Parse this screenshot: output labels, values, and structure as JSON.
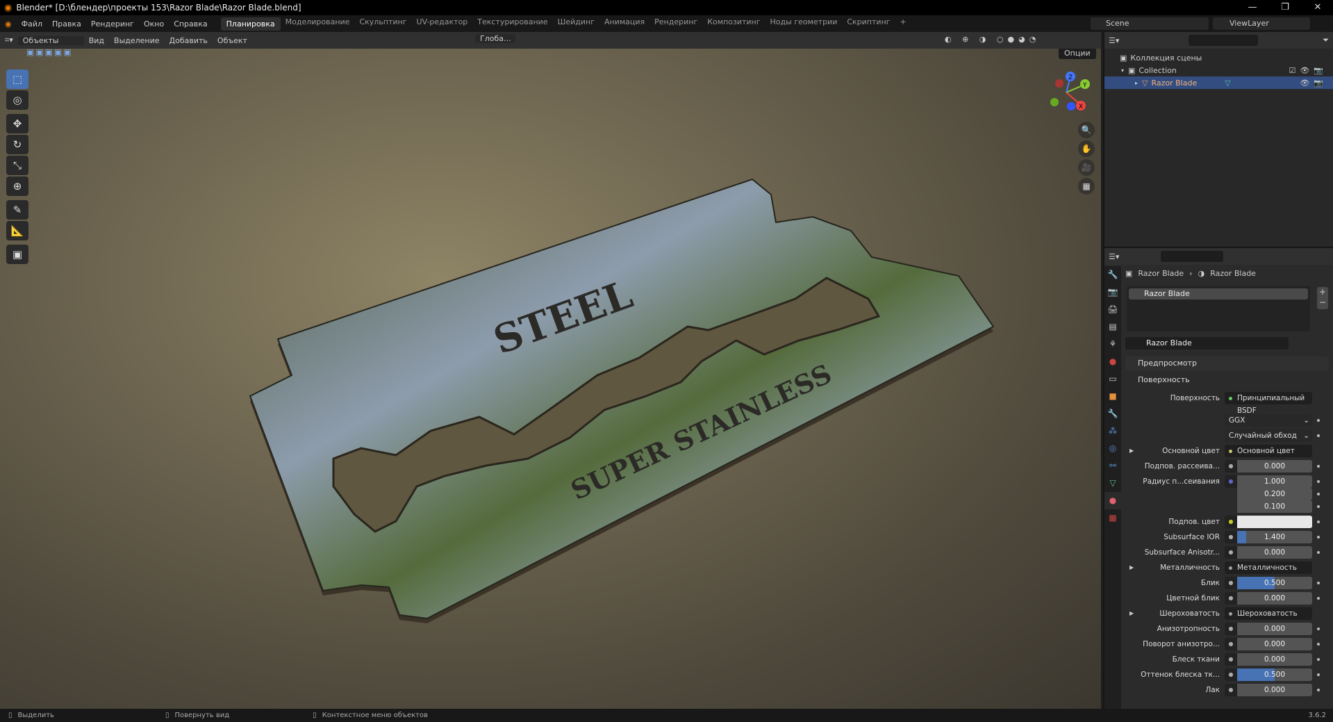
{
  "window": {
    "title": "Blender* [D:\\блендер\\проекты 153\\Razor Blade\\Razor Blade.blend]",
    "minimize": "—",
    "restore": "❐",
    "close": "✕"
  },
  "menu": [
    "Файл",
    "Правка",
    "Рендеринг",
    "Окно",
    "Справка"
  ],
  "workspaces": [
    "Планировка",
    "Моделирование",
    "Скульптинг",
    "UV-редактор",
    "Текстурирование",
    "Шейдинг",
    "Анимация",
    "Рендеринг",
    "Композитинг",
    "Ноды геометрии",
    "Скриптинг",
    "+"
  ],
  "scene": "Scene",
  "view_layer": "ViewLayer",
  "viewport_header": {
    "mode": "Объекты",
    "menus": [
      "Вид",
      "Выделение",
      "Добавить",
      "Объект"
    ],
    "orientation": "Глоба...",
    "options": "Опции"
  },
  "blade_text": {
    "top": "STEEL",
    "bottom": "SUPER  STAINLESS"
  },
  "gizmo": {
    "x": "X",
    "y": "Y",
    "z": "Z"
  },
  "outliner": {
    "scene_collection": "Коллекция сцены",
    "collection": "Collection",
    "object": "Razor Blade"
  },
  "props": {
    "breadcrumb_object": "Razor Blade",
    "breadcrumb_material": "Razor Blade",
    "slot": "Razor Blade",
    "material_name": "Razor Blade",
    "preview": "Предпросмотр",
    "surface_panel": "Поверхность",
    "surface_label": "Поверхность",
    "surface_value": "Принципиальный BSDF",
    "distribution": "GGX",
    "subsurface_method": "Случайный обход",
    "rows": [
      {
        "label": "Основной цвет",
        "link": "Основной цвет",
        "sock": "#c7c76a",
        "expand": true
      },
      {
        "label": "Подпов. рассеива...",
        "value": "0.000",
        "fill": 0
      },
      {
        "label": "Радиус п...сеивания",
        "value": "1.000",
        "fill": 0,
        "sock": "#6363c7"
      },
      {
        "label": "",
        "value": "0.200",
        "fill": 0
      },
      {
        "label": "",
        "value": "0.100",
        "fill": 0
      },
      {
        "label": "Подпов. цвет",
        "color": "#e8e8e8",
        "sock": "#c7c729"
      },
      {
        "label": "Subsurface IOR",
        "value": "1.400",
        "fill": 0.12
      },
      {
        "label": "Subsurface Anisotr...",
        "value": "0.000",
        "fill": 0
      },
      {
        "label": "Металличность",
        "link": "Металличность",
        "sock": "#a1a1a1",
        "expand": true
      },
      {
        "label": "Блик",
        "value": "0.500",
        "fill": 0.5
      },
      {
        "label": "Цветной блик",
        "value": "0.000",
        "fill": 0
      },
      {
        "label": "Шероховатость",
        "link": "Шероховатость",
        "sock": "#a1a1a1",
        "expand": true
      },
      {
        "label": "Анизотропность",
        "value": "0.000",
        "fill": 0
      },
      {
        "label": "Поворот анизотро...",
        "value": "0.000",
        "fill": 0
      },
      {
        "label": "Блеск ткани",
        "value": "0.000",
        "fill": 0
      },
      {
        "label": "Оттенок блеска тк...",
        "value": "0.500",
        "fill": 0.5
      },
      {
        "label": "Лак",
        "value": "0.000",
        "fill": 0
      }
    ]
  },
  "status": {
    "select": "Выделить",
    "rotate": "Повернуть вид",
    "context": "Контекстное меню объектов",
    "version": "3.6.2"
  }
}
